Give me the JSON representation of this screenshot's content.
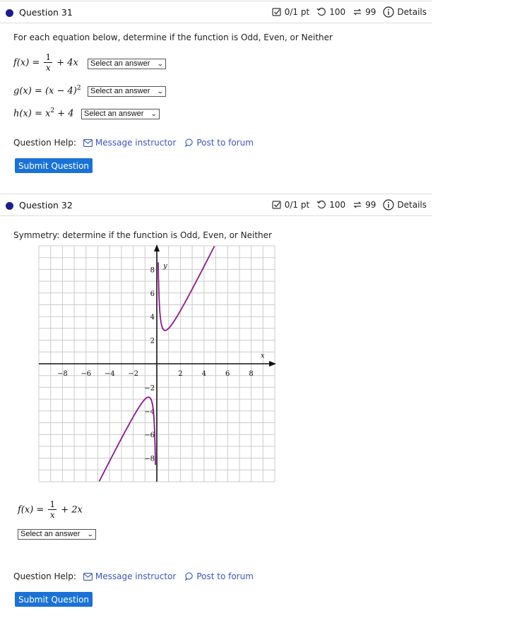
{
  "question1": {
    "title": "Question 31",
    "score": "0/1 pt",
    "attempts": "100",
    "retries": "99",
    "details_label": "Details",
    "instructions": "For each equation below, determine if the function is Odd, Even, or Neither",
    "equations": [
      {
        "lhs": "f(x) =",
        "frac_num": "1",
        "frac_den": "x",
        "rhs": "+ 4x",
        "select_value": "Select an answer"
      },
      {
        "lhs": "g(x) = (x − 4)",
        "sup": "2",
        "select_value": "Select an answer"
      },
      {
        "lhs": "h(x) = x",
        "sup": "2",
        "rhs": "+ 4",
        "select_value": "Select an answer"
      }
    ],
    "help_label": "Question Help:",
    "message_label": "Message instructor",
    "forum_label": "Post to forum",
    "submit_label": "Submit Question"
  },
  "question2": {
    "title": "Question 32",
    "score": "0/1 pt",
    "attempts": "100",
    "retries": "99",
    "details_label": "Details",
    "instructions": "Symmetry:  determine if the function is Odd, Even, or Neither",
    "equation": {
      "lhs": "f(x) =",
      "frac_num": "1",
      "frac_den": "x",
      "rhs": "+ 2x"
    },
    "select_value": "Select an answer",
    "help_label": "Question Help:",
    "message_label": "Message instructor",
    "forum_label": "Post to forum",
    "submit_label": "Submit Question"
  },
  "graph": {
    "x_label": "x",
    "y_label": "y",
    "x_ticks": [
      "−8",
      "−6",
      "−4",
      "−2",
      "2",
      "4",
      "6",
      "8"
    ],
    "y_ticks": [
      "8",
      "6",
      "4",
      "2",
      "−2",
      "−4",
      "−6",
      "−8"
    ],
    "curve_color": "#8b1a8b",
    "function": "1/x + 2x"
  },
  "colors": {
    "accent": "#1a72d6",
    "link": "#3b56b8",
    "bullet": "#1b1f8a"
  }
}
